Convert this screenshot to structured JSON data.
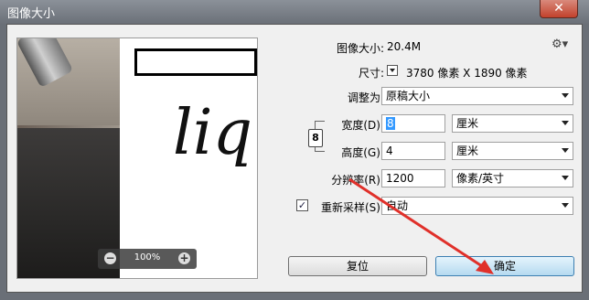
{
  "window": {
    "title": "图像大小",
    "close_symbol": "✕"
  },
  "preview": {
    "sample_text": "liq",
    "zoom_level": "100%",
    "zoom_out_symbol": "−",
    "zoom_in_symbol": "+"
  },
  "info": {
    "image_size_label": "图像大小:",
    "image_size_value": "20.4M",
    "dimensions_label": "尺寸:",
    "dimensions_value": "3780 像素  X  1890 像素"
  },
  "fit_to": {
    "label": "调整为:",
    "value": "原稿大小"
  },
  "width": {
    "label": "宽度(D):",
    "value": "8",
    "unit": "厘米"
  },
  "height": {
    "label": "高度(G):",
    "value": "4",
    "unit": "厘米"
  },
  "resolution": {
    "label": "分辨率(R):",
    "value": "1200",
    "unit": "像素/英寸"
  },
  "resample": {
    "label": "重新采样(S):",
    "checked": true,
    "check_symbol": "✓",
    "value": "自动"
  },
  "buttons": {
    "reset": "复位",
    "ok": "确定"
  },
  "icons": {
    "gear": "gear-icon",
    "link": "link-icon"
  },
  "colors": {
    "annotation_arrow": "#e0302a",
    "primary_button": "#3c7fb1"
  }
}
